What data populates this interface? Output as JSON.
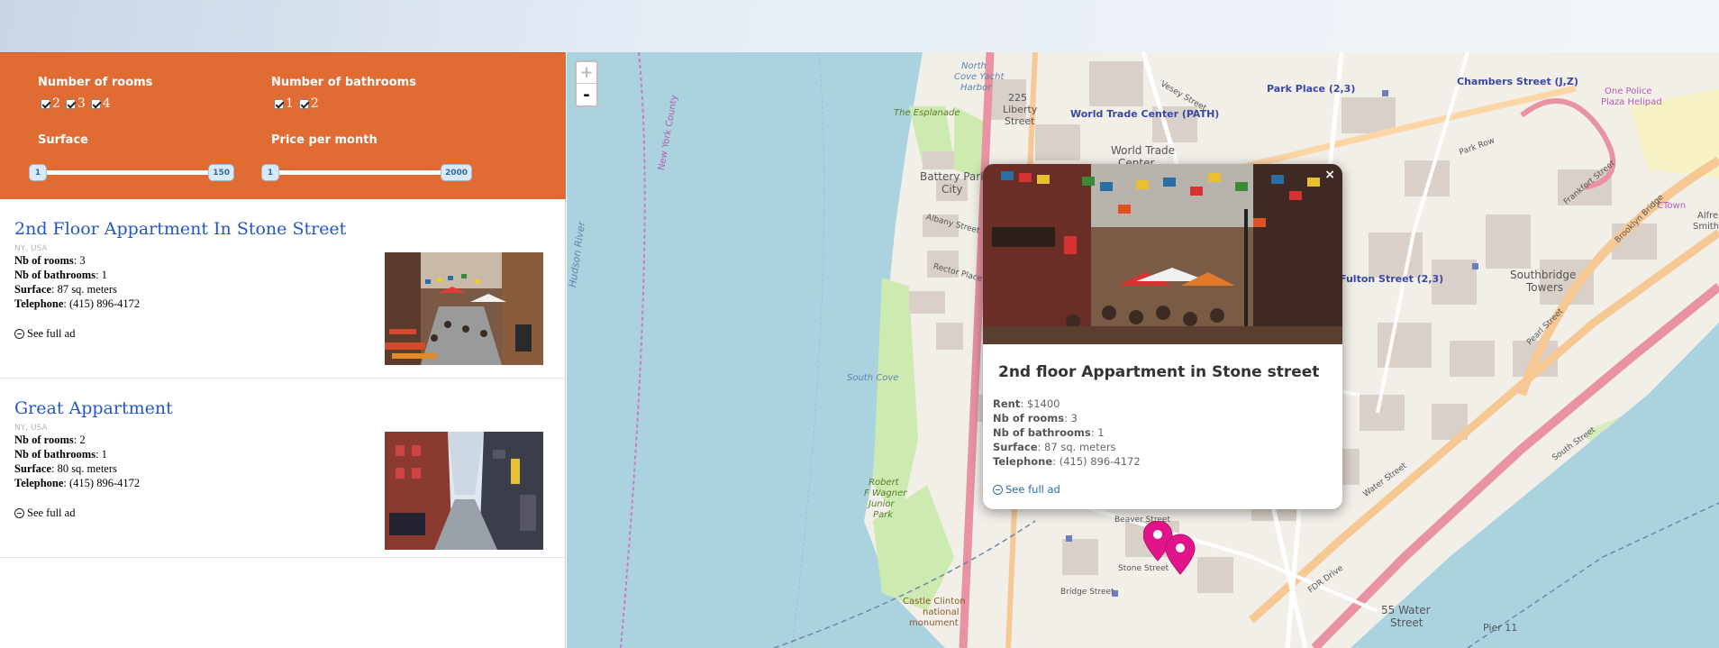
{
  "filters": {
    "rooms_label": "Number of rooms",
    "rooms_options": [
      "2",
      "3",
      "4"
    ],
    "bathrooms_label": "Number of bathrooms",
    "bathrooms_options": [
      "1",
      "2"
    ],
    "surface_label": "Surface",
    "surface_min": "1",
    "surface_max": "150",
    "price_label": "Price per month",
    "price_min": "1",
    "price_max": "2000"
  },
  "listings": [
    {
      "title": "2nd Floor Appartment In Stone Street",
      "location": "NY, USA",
      "rooms_label": "Nb of rooms",
      "rooms": ": 3",
      "bathrooms_label": "Nb of bathrooms",
      "bathrooms": ": 1",
      "surface_label": "Surface",
      "surface": ": 87 sq. meters",
      "phone_label": "Telephone",
      "phone": ": (415) 896-4172",
      "link": "See full ad"
    },
    {
      "title": "Great Appartment",
      "location": "NY, USA",
      "rooms_label": "Nb of rooms",
      "rooms": ": 2",
      "bathrooms_label": "Nb of bathrooms",
      "bathrooms": ": 1",
      "surface_label": "Surface",
      "surface": ": 80 sq. meters",
      "phone_label": "Telephone",
      "phone": ": (415) 896-4172",
      "link": "See full ad"
    }
  ],
  "map": {
    "zoom_in": "+",
    "zoom_out": "-",
    "labels": {
      "wtc": "World Trade Center (PATH)",
      "wtc2": "World Trade",
      "wtc3": "Center",
      "park_place": "Park Place (2,3)",
      "chambers": "Chambers Street (J,Z)",
      "fulton": "Fulton Street (2,3)",
      "battery": "Battery Park",
      "city": "City",
      "hudson": "Hudson River",
      "nj": "New York County",
      "esplanade": "The Esplanade",
      "north_cove": "North",
      "north_cove2": "Cove Yacht",
      "north_cove3": "Harbor",
      "liberty": "225",
      "liberty2": "Liberty",
      "liberty3": "Street",
      "southbridge": "Southbridge",
      "towers": "Towers",
      "water55": "55 Water",
      "water55b": "Street",
      "pier": "Pier 11",
      "castle": "Castle Clinton",
      "castle2": "national",
      "castle3": "monument",
      "wagner": "Robert",
      "wagner2": "F Wagner",
      "wagner3": "Junior",
      "wagner4": "Park",
      "south_cove": "South Cove",
      "stone": "Stone Street",
      "bridge_st": "Bridge Street",
      "beaver": "Beaver Street",
      "fdr": "FDR Drive",
      "south_st": "South Street",
      "water_st": "Water Street",
      "pearl": "Pearl Street",
      "one_police": "One Police",
      "one_police2": "Plaza Helipad",
      "ctown": "CTown",
      "smith": "Alfre",
      "smith2": "Smith H",
      "park_row": "Park Row",
      "vesey": "Vesey Street",
      "albany": "Albany Street",
      "rector": "Rector Place",
      "brooklyn": "Brooklyn Bridge",
      "frankfort": "Frankfort Street"
    }
  },
  "popup": {
    "close": "×",
    "title": "2nd floor Appartment in Stone street",
    "rent_label": "Rent",
    "rent": ": $1400",
    "rooms_label": "Nb of rooms",
    "rooms": ": 3",
    "bathrooms_label": "Nb of bathrooms",
    "bathrooms": ": 1",
    "surface_label": "Surface",
    "surface": ": 87 sq. meters",
    "phone_label": "Telephone",
    "phone": ": (415) 896-4172",
    "link": "See full ad"
  },
  "colors": {
    "filter_bg": "#e06b33",
    "link": "#2457c5",
    "marker": "#e2148c",
    "water": "#aad3df"
  }
}
